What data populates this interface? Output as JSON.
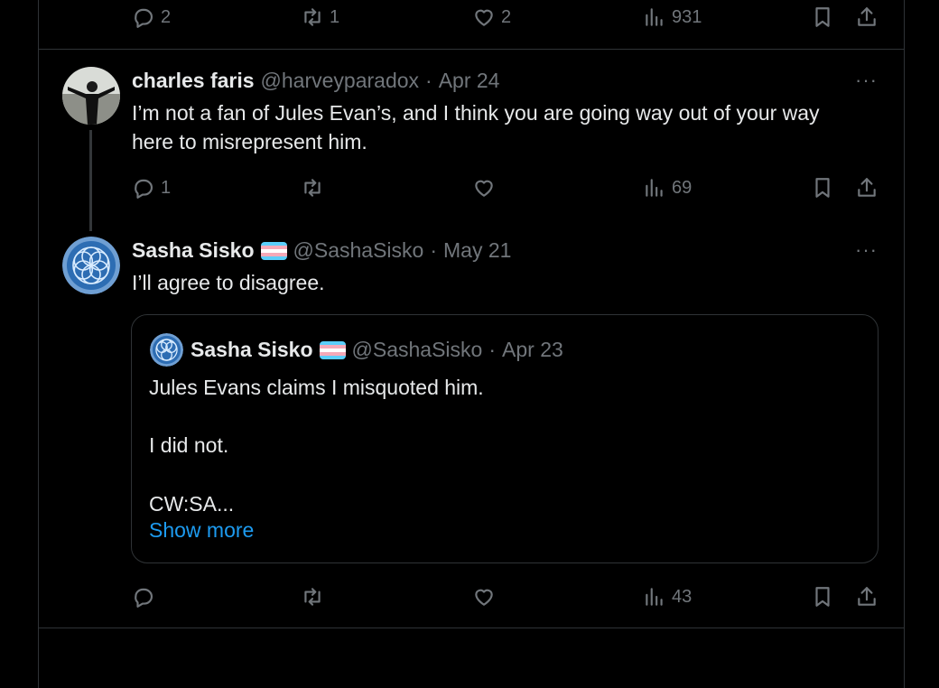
{
  "top_actions": {
    "replies": "2",
    "retweets": "1",
    "likes": "2",
    "views": "931"
  },
  "tweet1": {
    "name": "charles faris",
    "handle": "@harveyparadox",
    "separator": "·",
    "date": "Apr 24",
    "text_line1": "I’m not a fan of Jules Evan’s, and I think you are going way out of your way",
    "text_line2": "here to misrepresent him.",
    "actions": {
      "replies": "1",
      "retweets": "",
      "likes": "",
      "views": "69"
    }
  },
  "tweet2": {
    "name": "Sasha Sisko",
    "handle": "@SashaSisko",
    "separator": "·",
    "date": "May 21",
    "text": "I’ll agree to disagree.",
    "actions": {
      "replies": "",
      "retweets": "",
      "likes": "",
      "views": "43"
    }
  },
  "quote": {
    "name": "Sasha Sisko",
    "handle": "@SashaSisko",
    "separator": "·",
    "date": "Apr 23",
    "line1": "Jules Evans claims I misquoted him.",
    "line2": "I did not.",
    "line3": "CW:SA...",
    "show_more": "Show more"
  },
  "icons": {
    "reply": "reply-icon",
    "retweet": "retweet-icon",
    "like": "heart-icon",
    "views": "views-icon",
    "bookmark": "bookmark-icon",
    "share": "share-icon",
    "more": "more-icon",
    "flag": "trans-flag-icon"
  },
  "colors": {
    "background": "#000000",
    "text": "#e7e9ea",
    "muted": "#71767b",
    "border": "#2f3336",
    "link": "#1d9bf0",
    "flag_blue": "#5bcefa",
    "flag_pink": "#f5a9b8",
    "flag_white": "#ffffff"
  }
}
